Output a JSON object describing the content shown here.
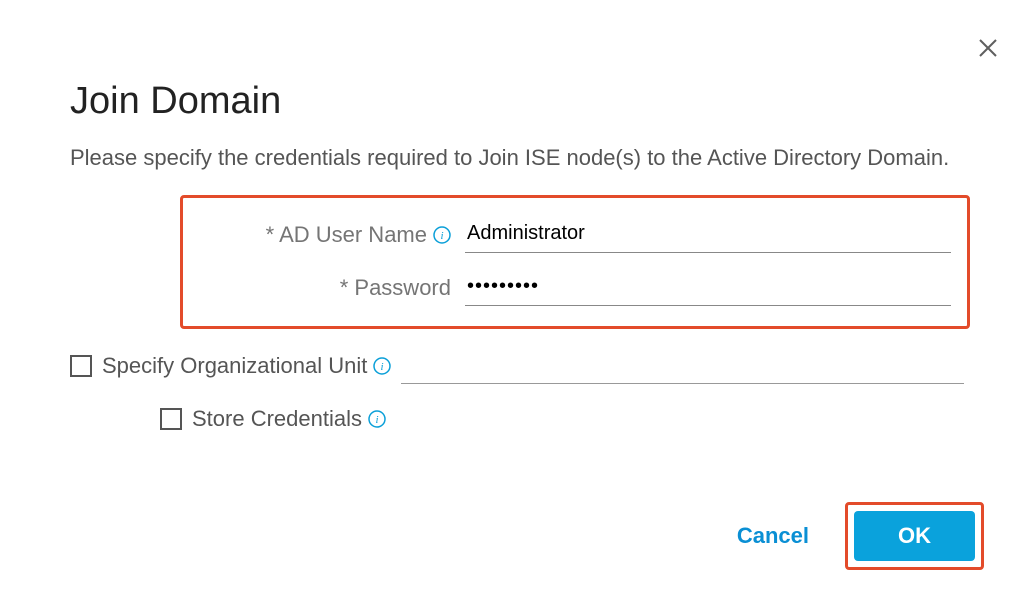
{
  "dialog": {
    "title": "Join Domain",
    "description": "Please specify the credentials required to Join ISE node(s) to the Active Directory Domain."
  },
  "fields": {
    "ad_user_label": "* AD User Name",
    "ad_user_value": "Administrator",
    "password_label": "* Password",
    "password_value": "•••••••••",
    "ou_checkbox_label": "Specify Organizational Unit",
    "ou_value": "",
    "store_cred_label": "Store Credentials"
  },
  "buttons": {
    "cancel": "Cancel",
    "ok": "OK"
  }
}
